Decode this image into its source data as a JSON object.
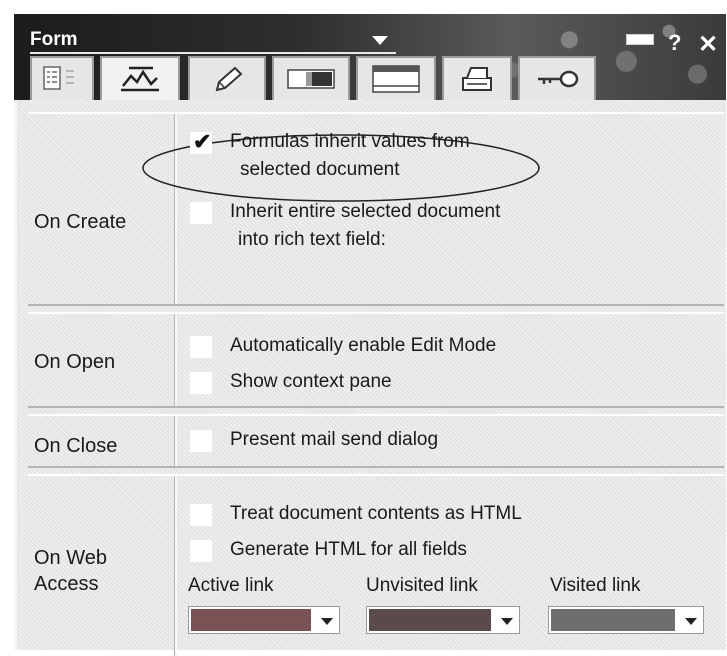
{
  "titlebar": {
    "title": "Form"
  },
  "tabs": [
    {
      "name": "info-tab-icon"
    },
    {
      "name": "launch-tab-icon"
    },
    {
      "name": "pen-tab-icon"
    },
    {
      "name": "background-tab-icon"
    },
    {
      "name": "header-footer-tab-icon"
    },
    {
      "name": "print-tab-icon"
    },
    {
      "name": "key-tab-icon"
    }
  ],
  "sections": {
    "on_create": {
      "label": "On Create",
      "option1": {
        "line1": "Formulas inherit values from",
        "line2": "selected document",
        "checked": true
      },
      "option2": {
        "line1": "Inherit entire selected document",
        "line2": "into rich text field:",
        "checked": false
      }
    },
    "on_open": {
      "label": "On Open",
      "option1": {
        "text": "Automatically enable Edit Mode",
        "checked": false
      },
      "option2": {
        "text": "Show context pane",
        "checked": false
      }
    },
    "on_close": {
      "label": "On Close",
      "option1": {
        "text": "Present mail send dialog",
        "checked": false
      }
    },
    "on_web_access": {
      "label_line1": "On Web",
      "label_line2": "Access",
      "option1": {
        "text": "Treat document contents as HTML",
        "checked": false
      },
      "option2": {
        "text": "Generate HTML for all fields",
        "checked": false
      },
      "colors": {
        "active_link": {
          "label": "Active link",
          "color": "#7a5252"
        },
        "unvisited_link": {
          "label": "Unvisited link",
          "color": "#5a4a4a"
        },
        "visited_link": {
          "label": "Visited link",
          "color": "#6e6e6e"
        }
      }
    }
  },
  "checkmark_glyph": "✔"
}
